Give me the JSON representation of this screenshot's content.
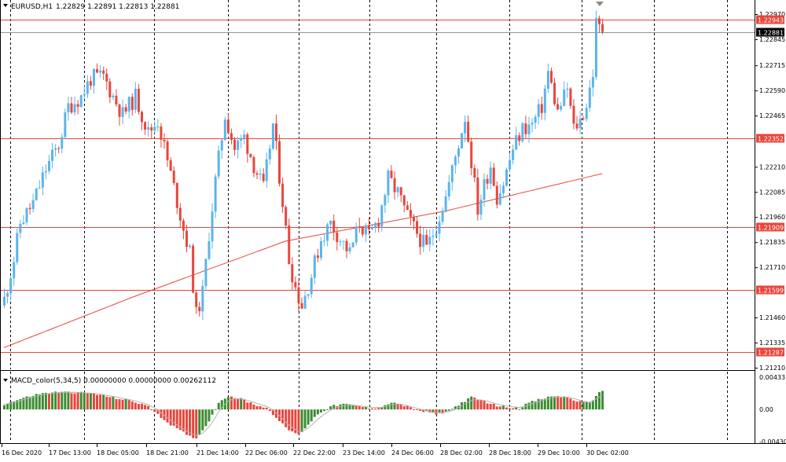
{
  "header": {
    "symbol": "EURUSD,H1",
    "ohlc": "1.22829 1.22891 1.22813 1.22881"
  },
  "indicator": {
    "label": "MACD_color(5,34,5) 0.00000000 0.00000000 0.00262112"
  },
  "colors": {
    "bull": "#5ab4ec",
    "bear": "#e8463c",
    "ma": "#e8463c",
    "level": "#e8463c",
    "hist_up": "#3c8c32",
    "hist_down": "#e8463c",
    "signal": "#b4b4b4",
    "grid": "#000000",
    "current": "#000000"
  },
  "chart_data": [
    {
      "type": "candlestick",
      "title": "EURUSD,H1",
      "ylim": [
        1.2121,
        1.2297
      ],
      "y_ticks": [
        "1.22970",
        "1.22845",
        "1.22715",
        "1.22590",
        "1.22465",
        "1.22210",
        "1.22085",
        "1.21960",
        "1.21835",
        "1.21710",
        "1.21460",
        "1.21335",
        "1.21210"
      ],
      "x_ticks": [
        "16 Dec 2020",
        "17 Dec 13:00",
        "18 Dec 05:00",
        "18 Dec 21:00",
        "21 Dec 14:00",
        "22 Dec 06:00",
        "22 Dec 22:00",
        "23 Dec 14:00",
        "24 Dec 06:00",
        "28 Dec 02:00",
        "28 Dec 18:00",
        "29 Dec 10:00",
        "30 Dec 02:00"
      ],
      "grid": true,
      "levels": [
        "1.22943",
        "1.22352",
        "1.21909",
        "1.21599",
        "1.21287"
      ],
      "current_price": "1.22881",
      "keypoints": [
        [
          0,
          1.2155
        ],
        [
          3,
          1.2175
        ],
        [
          5,
          1.2193
        ],
        [
          9,
          1.2203
        ],
        [
          13,
          1.222
        ],
        [
          17,
          1.2232
        ],
        [
          20,
          1.2251
        ],
        [
          24,
          1.2256
        ],
        [
          27,
          1.2265
        ],
        [
          31,
          1.2266
        ],
        [
          34,
          1.2256
        ],
        [
          37,
          1.2247
        ],
        [
          41,
          1.2256
        ],
        [
          45,
          1.2238
        ],
        [
          48,
          1.2244
        ],
        [
          51,
          1.2224
        ],
        [
          54,
          1.2204
        ],
        [
          56,
          1.219
        ],
        [
          58,
          1.2178
        ],
        [
          60,
          1.2147
        ],
        [
          62,
          1.2158
        ],
        [
          64,
          1.2188
        ],
        [
          66,
          1.2214
        ],
        [
          69,
          1.2247
        ],
        [
          72,
          1.223
        ],
        [
          75,
          1.2236
        ],
        [
          78,
          1.2222
        ],
        [
          81,
          1.221
        ],
        [
          84,
          1.2242
        ],
        [
          87,
          1.2204
        ],
        [
          89,
          1.2175
        ],
        [
          91,
          1.2161
        ],
        [
          93,
          1.2152
        ],
        [
          96,
          1.2167
        ],
        [
          99,
          1.2185
        ],
        [
          102,
          1.2193
        ],
        [
          105,
          1.2185
        ],
        [
          108,
          1.2178
        ],
        [
          111,
          1.2193
        ],
        [
          114,
          1.2186
        ],
        [
          117,
          1.2195
        ],
        [
          120,
          1.2215
        ],
        [
          123,
          1.2208
        ],
        [
          126,
          1.2196
        ],
        [
          129,
          1.2188
        ],
        [
          132,
          1.218
        ],
        [
          135,
          1.2192
        ],
        [
          138,
          1.2206
        ],
        [
          141,
          1.2226
        ],
        [
          144,
          1.2246
        ],
        [
          146,
          1.2224
        ],
        [
          148,
          1.22
        ],
        [
          150,
          1.2212
        ],
        [
          152,
          1.2222
        ],
        [
          154,
          1.2206
        ],
        [
          156,
          1.2213
        ],
        [
          159,
          1.223
        ],
        [
          162,
          1.224
        ],
        [
          165,
          1.2242
        ],
        [
          168,
          1.2251
        ],
        [
          170,
          1.2268
        ],
        [
          173,
          1.2248
        ],
        [
          176,
          1.226
        ],
        [
          178,
          1.224
        ],
        [
          180,
          1.2244
        ],
        [
          182,
          1.2252
        ],
        [
          184,
          1.2268
        ],
        [
          185,
          1.2292
        ],
        [
          187,
          1.22881
        ]
      ],
      "ma_line": [
        [
          0,
          1.2131
        ],
        [
          40,
          1.2156
        ],
        [
          88,
          1.2184
        ],
        [
          138,
          1.2199
        ],
        [
          188,
          1.2218
        ]
      ]
    },
    {
      "type": "bar",
      "title": "MACD_color(5,34,5)",
      "ylim": [
        -0.0043,
        0.00433
      ],
      "y_ticks": [
        "0.004331",
        "0.00",
        "-0.00430"
      ],
      "keypoints": [
        [
          0,
          0.0007
        ],
        [
          5,
          0.0014
        ],
        [
          10,
          0.002
        ],
        [
          15,
          0.0023
        ],
        [
          22,
          0.0023
        ],
        [
          28,
          0.0021
        ],
        [
          34,
          0.0016
        ],
        [
          40,
          0.0011
        ],
        [
          44,
          0.0006
        ],
        [
          47,
          -0.0002
        ],
        [
          50,
          -0.0014
        ],
        [
          54,
          -0.0026
        ],
        [
          58,
          -0.0036
        ],
        [
          60,
          -0.0038
        ],
        [
          62,
          -0.0028
        ],
        [
          65,
          -0.0008
        ],
        [
          67,
          0.001
        ],
        [
          70,
          0.0018
        ],
        [
          74,
          0.0014
        ],
        [
          78,
          0.0007
        ],
        [
          82,
          0.0002
        ],
        [
          85,
          -0.001
        ],
        [
          88,
          -0.0025
        ],
        [
          92,
          -0.0034
        ],
        [
          95,
          -0.002
        ],
        [
          98,
          -0.0006
        ],
        [
          102,
          0.0004
        ],
        [
          106,
          0.0007
        ],
        [
          110,
          0.0005
        ],
        [
          114,
          0.0002
        ],
        [
          118,
          0.0003
        ],
        [
          120,
          0.0008
        ],
        [
          123,
          0.0008
        ],
        [
          127,
          0.0002
        ],
        [
          131,
          -0.0003
        ],
        [
          135,
          -0.0006
        ],
        [
          139,
          -0.0002
        ],
        [
          143,
          0.0009
        ],
        [
          146,
          0.0016
        ],
        [
          150,
          0.0011
        ],
        [
          154,
          0.0005
        ],
        [
          158,
          0.0003
        ],
        [
          161,
          0.0002
        ],
        [
          164,
          0.0009
        ],
        [
          168,
          0.0014
        ],
        [
          172,
          0.0018
        ],
        [
          176,
          0.0016
        ],
        [
          180,
          0.001
        ],
        [
          183,
          0.0008
        ],
        [
          185,
          0.0019
        ],
        [
          187,
          0.0025
        ]
      ]
    }
  ]
}
